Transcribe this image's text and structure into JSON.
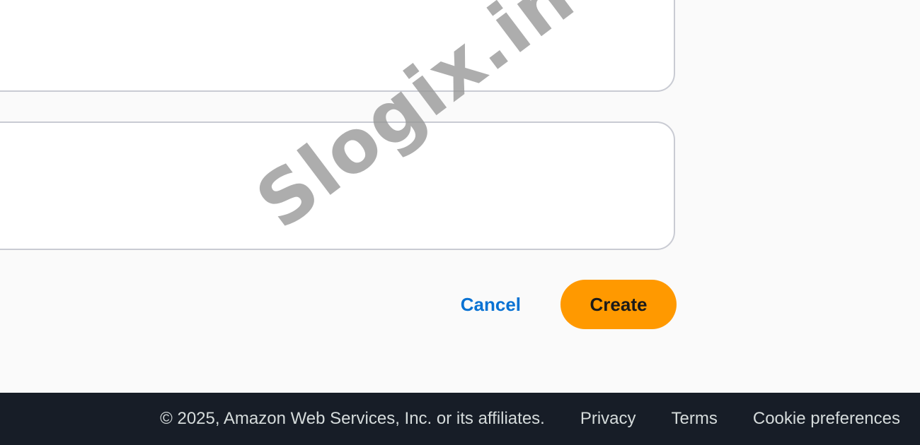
{
  "form": {
    "cancel_label": "Cancel",
    "create_label": "Create"
  },
  "watermark": "Slogix.in",
  "footer": {
    "copyright": "© 2025, Amazon Web Services, Inc. or its affiliates.",
    "privacy": "Privacy",
    "terms": "Terms",
    "cookie_preferences": "Cookie preferences"
  },
  "colors": {
    "primary": "#ff9900",
    "link": "#0972d3",
    "footer_bg": "#171d27"
  }
}
